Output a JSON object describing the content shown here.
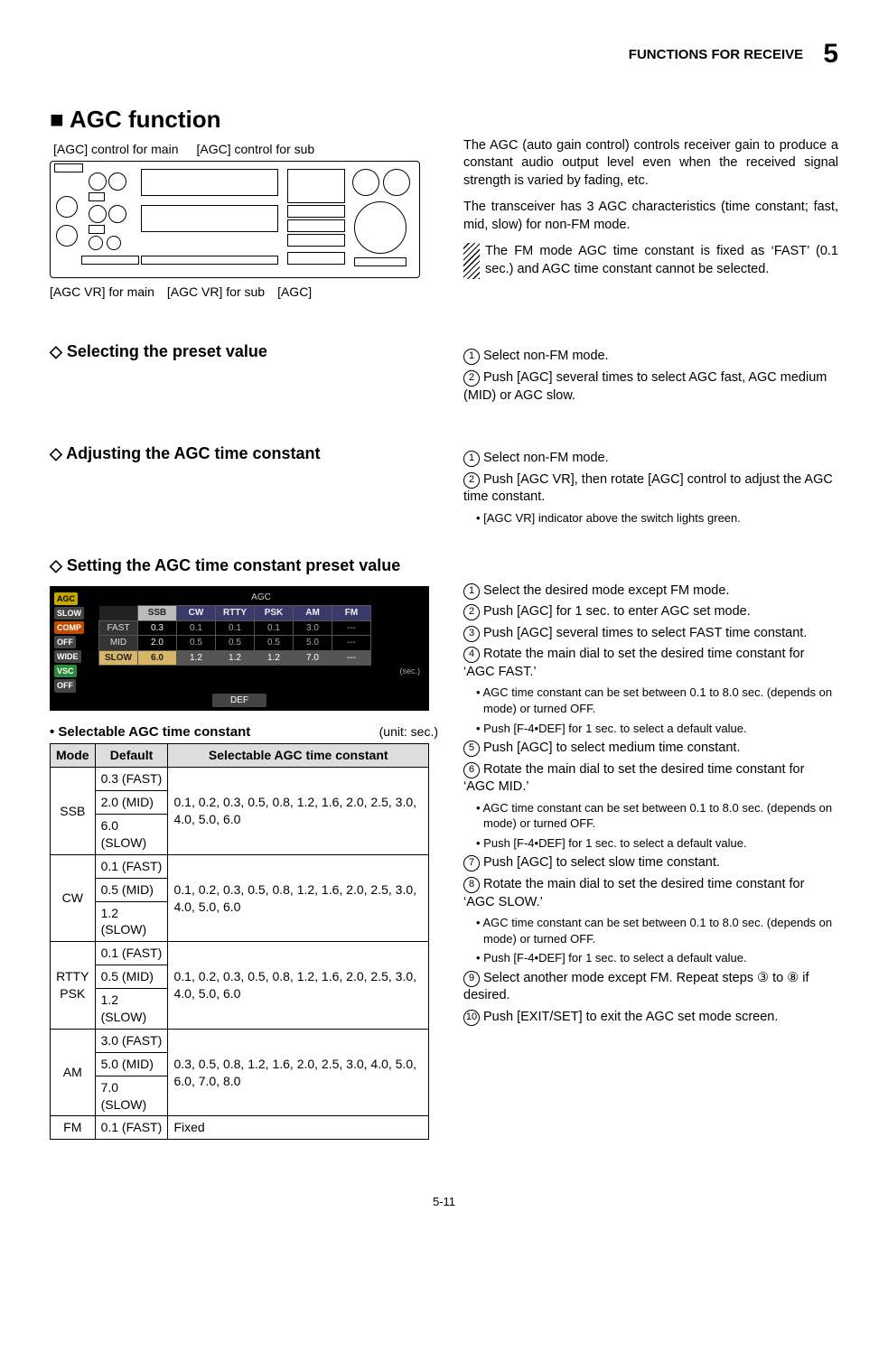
{
  "header": {
    "section": "FUNCTIONS FOR RECEIVE",
    "chapter": "5"
  },
  "title": "■ AGC function",
  "diagram": {
    "top_labels": [
      "[AGC] control for main",
      "[AGC] control for sub"
    ],
    "bottom_labels": [
      "[AGC VR] for main",
      "[AGC VR] for sub",
      "[AGC]"
    ]
  },
  "intro": {
    "p1": "The AGC (auto gain control) controls receiver gain to produce a constant audio output level even when the received signal strength is varied by fading, etc.",
    "p2": "The transceiver has 3 AGC characteristics (time constant; fast, mid, slow) for non-FM mode.",
    "note": "The FM mode AGC time constant is fixed as ‘FAST’ (0.1 sec.) and AGC time constant cannot be selected."
  },
  "sec1": {
    "heading": "◇ Selecting the preset value",
    "steps": [
      "Select non-FM mode.",
      "Push [AGC] several times to select AGC fast, AGC medium (MID) or AGC slow."
    ]
  },
  "sec2": {
    "heading": "◇ Adjusting the AGC time constant",
    "steps": {
      "s1": "Select non-FM mode.",
      "s2": "Push [AGC VR], then rotate [AGC] control to adjust the AGC time constant.",
      "s2_sub": "[AGC VR] indicator above the switch lights green."
    }
  },
  "sec3": {
    "heading": "◇ Setting the AGC time constant preset value",
    "lcd": {
      "title": "AGC",
      "left_badges": [
        {
          "text": "AGC",
          "bg": "#c7a800",
          "fg": "#000"
        },
        {
          "text": "SLOW",
          "bg": "#444",
          "fg": "#fff"
        },
        {
          "text": "COMP",
          "bg": "#c04a00",
          "fg": "#fff"
        },
        {
          "text": "OFF",
          "bg": "#444",
          "fg": "#fff"
        },
        {
          "text": "WIDE",
          "bg": "#444",
          "fg": "#fff"
        },
        {
          "text": "VSC",
          "bg": "#2a8a3a",
          "fg": "#fff"
        },
        {
          "text": "OFF",
          "bg": "#444",
          "fg": "#fff"
        }
      ],
      "modes": [
        "SSB",
        "CW",
        "RTTY",
        "PSK",
        "AM",
        "FM"
      ],
      "rows": [
        {
          "label": "FAST",
          "vals": [
            "0.3",
            "0.1",
            "0.1",
            "0.1",
            "3.0",
            "---"
          ]
        },
        {
          "label": "MID",
          "vals": [
            "2.0",
            "0.5",
            "0.5",
            "0.5",
            "5.0",
            "---"
          ]
        },
        {
          "label": "SLOW",
          "vals": [
            "6.0",
            "1.2",
            "1.2",
            "1.2",
            "7.0",
            "---"
          ]
        }
      ],
      "unit": "(sec.)",
      "def_btn": "DEF"
    },
    "steps": {
      "s1": "Select the desired mode except FM mode.",
      "s2": "Push [AGC] for 1 sec. to enter AGC set mode.",
      "s3": "Push [AGC] several times to select FAST time constant.",
      "s4": "Rotate the main dial to set the desired time constant for ‘AGC FAST.’",
      "s4_sub1": "AGC time constant can be set between 0.1 to 8.0 sec. (depends on mode) or turned OFF.",
      "s4_sub2": "Push [F-4•DEF] for 1 sec. to select a default value.",
      "s5": "Push [AGC] to select medium time constant.",
      "s6": "Rotate the main dial to set the desired time constant for ‘AGC MID.’",
      "s6_sub1": "AGC time constant can be set between 0.1 to 8.0 sec. (depends on mode) or turned OFF.",
      "s6_sub2": "Push [F-4•DEF] for 1 sec. to select a default value.",
      "s7": "Push [AGC] to select slow time constant.",
      "s8": "Rotate the main dial to set the desired time constant for ‘AGC SLOW.’",
      "s8_sub1": "AGC time constant can be set between 0.1 to 8.0 sec. (depends on mode) or turned OFF.",
      "s8_sub2": "Push [F-4•DEF] for 1 sec. to select a default value.",
      "s9": "Select another mode except FM. Repeat steps ③ to ⑧ if desired.",
      "s10": "Push [EXIT/SET] to exit the AGC set mode screen."
    }
  },
  "table": {
    "title": "• Selectable AGC time constant",
    "unit": "(unit: sec.)",
    "headers": [
      "Mode",
      "Default",
      "Selectable AGC time constant"
    ],
    "rows": [
      {
        "mode": "SSB",
        "defaults": [
          "0.3 (FAST)",
          "2.0 (MID)",
          "6.0 (SLOW)"
        ],
        "sel": "0.1, 0.2, 0.3, 0.5, 0.8, 1.2, 1.6, 2.0, 2.5, 3.0, 4.0, 5.0, 6.0"
      },
      {
        "mode": "CW",
        "defaults": [
          "0.1 (FAST)",
          "0.5 (MID)",
          "1.2 (SLOW)"
        ],
        "sel": "0.1, 0.2, 0.3, 0.5, 0.8, 1.2, 1.6, 2.0, 2.5, 3.0, 4.0, 5.0, 6.0"
      },
      {
        "mode": "RTTY\nPSK",
        "defaults": [
          "0.1 (FAST)",
          "0.5 (MID)",
          "1.2 (SLOW)"
        ],
        "sel": "0.1, 0.2, 0.3, 0.5, 0.8, 1.2, 1.6, 2.0, 2.5, 3.0, 4.0, 5.0, 6.0"
      },
      {
        "mode": "AM",
        "defaults": [
          "3.0 (FAST)",
          "5.0 (MID)",
          "7.0 (SLOW)"
        ],
        "sel": "0.3, 0.5, 0.8, 1.2, 1.6, 2.0, 2.5, 3.0, 4.0, 5.0, 6.0, 7.0, 8.0"
      },
      {
        "mode": "FM",
        "defaults": [
          "0.1 (FAST)"
        ],
        "sel": "Fixed"
      }
    ]
  },
  "page": "5-11"
}
